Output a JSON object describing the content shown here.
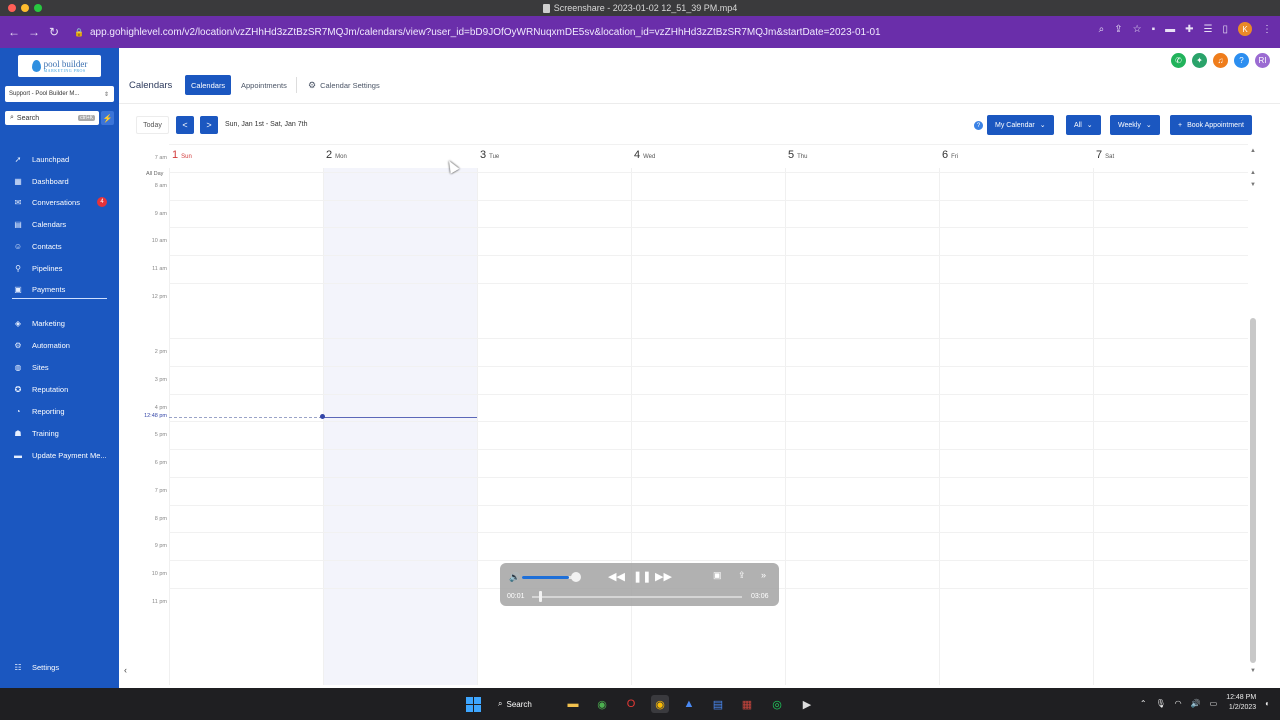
{
  "window": {
    "title": "Screenshare - 2023-01-02 12_51_39 PM.mp4"
  },
  "browser": {
    "url": "app.gohighlevel.com/v2/location/vzZHhHd3zZtBzSR7MQJm/calendars/view?user_id=bD9JOfOyWRNuqxmDE5sv&location_id=vzZHhHd3zZtBzSR7MQJm&startDate=2023-01-01",
    "profile_initial": "K"
  },
  "sidebar": {
    "logo_name": "pool builder",
    "logo_sub": "MARKETING PROS",
    "account": "Support - Pool Builder M...",
    "search_placeholder": "Search",
    "search_kbd": "ctrl+K",
    "items": [
      {
        "label": "Launchpad",
        "icon": "rocket-icon",
        "glyph": "➚"
      },
      {
        "label": "Dashboard",
        "icon": "dashboard-icon",
        "glyph": "▦"
      },
      {
        "label": "Conversations",
        "icon": "chat-icon",
        "glyph": "✉",
        "badge": "4"
      },
      {
        "label": "Calendars",
        "icon": "calendar-icon",
        "glyph": "▤"
      },
      {
        "label": "Contacts",
        "icon": "contacts-icon",
        "glyph": "☺"
      },
      {
        "label": "Pipelines",
        "icon": "funnel-icon",
        "glyph": "⚲"
      },
      {
        "label": "Payments",
        "icon": "payments-icon",
        "glyph": "▣"
      },
      {
        "label": "Marketing",
        "icon": "megaphone-icon",
        "glyph": "◈"
      },
      {
        "label": "Automation",
        "icon": "automation-icon",
        "glyph": "⚙"
      },
      {
        "label": "Sites",
        "icon": "globe-icon",
        "glyph": "◍"
      },
      {
        "label": "Reputation",
        "icon": "star-icon",
        "glyph": "✪"
      },
      {
        "label": "Reporting",
        "icon": "chart-icon",
        "glyph": "◔"
      },
      {
        "label": "Training",
        "icon": "graduation-cap-icon",
        "glyph": "☗"
      },
      {
        "label": "Update Payment Me...",
        "icon": "card-icon",
        "glyph": "▬"
      }
    ],
    "settings_label": "Settings"
  },
  "header": {
    "page_title": "Calendars",
    "tabs": [
      {
        "label": "Calendars",
        "active": true
      },
      {
        "label": "Appointments",
        "active": false
      },
      {
        "label": "Calendar Settings",
        "active": false
      }
    ]
  },
  "toolbar": {
    "today": "Today",
    "prev": "<",
    "next": ">",
    "date_range": "Sun, Jan 1st - Sat, Jan 7th",
    "my_calendar": "My Calendar",
    "filter_all": "All",
    "view_weekly": "Weekly",
    "book_appointment": "Book Appointment"
  },
  "calendar": {
    "all_day_label": "All Day",
    "days": [
      {
        "num": "1",
        "name": "Sun"
      },
      {
        "num": "2",
        "name": "Mon"
      },
      {
        "num": "3",
        "name": "Tue"
      },
      {
        "num": "4",
        "name": "Wed"
      },
      {
        "num": "5",
        "name": "Thu"
      },
      {
        "num": "6",
        "name": "Fri"
      },
      {
        "num": "7",
        "name": "Sat"
      }
    ],
    "hours": [
      "7 am",
      "8 am",
      "9 am",
      "10 am",
      "11 am",
      "12 pm",
      "2 pm",
      "3 pm",
      "4 pm",
      "5 pm",
      "6 pm",
      "7 pm",
      "8 pm",
      "9 pm",
      "10 pm",
      "11 pm"
    ],
    "now_label": "12:48 pm"
  },
  "player": {
    "elapsed": "00:01",
    "duration": "03:06",
    "volume_fraction": 0.85,
    "progress_fraction": 0.005
  },
  "taskbar": {
    "search": "Search",
    "time": "12:48 PM",
    "date": "1/2/2023"
  },
  "colors": {
    "sidebar": "#1b57c0",
    "primary": "#1b57c0",
    "browser_toolbar": "#6a2eaa",
    "badge": "#e5333a"
  }
}
